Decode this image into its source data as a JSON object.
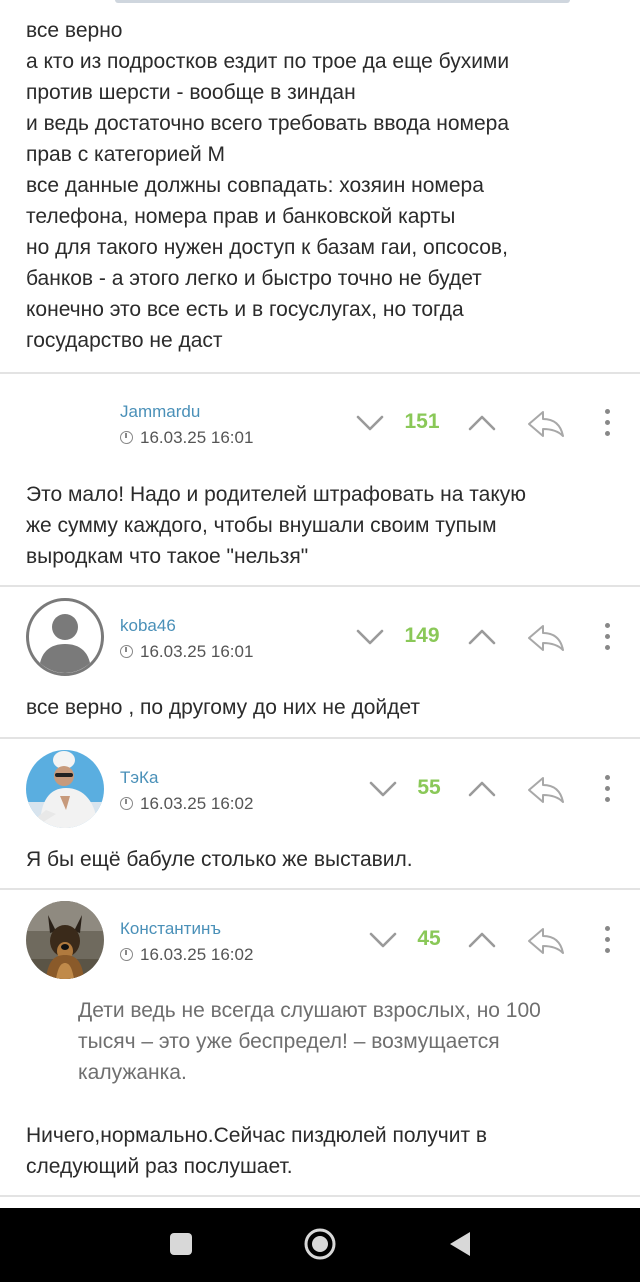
{
  "post": {
    "lines": [
      "все верно",
      "а кто из подростков ездит по трое да еще бухими",
      "против шерсти - вообще в зиндан",
      "и ведь достаточно всего требовать ввода номера",
      "прав с категорией М",
      "все данные должны совпадать: хозяин номера",
      "телефона, номера прав и банковской карты",
      "но для такого нужен доступ к базам гаи, опсосов,",
      "банков - а этого легко и быстро точно не будет",
      "конечно это все есть и в госуслугах, но тогда",
      "государство не даст"
    ]
  },
  "comments": [
    {
      "username": "Jammardu",
      "time": "16.03.25 16:01",
      "rating": "151",
      "text_lines": [
        "Это мало! Надо и родителей штрафовать на такую",
        "же сумму каждого, чтобы внушали своим тупым",
        "выродкам что такое \"нельзя\""
      ]
    },
    {
      "username": "koba46",
      "time": "16.03.25 16:01",
      "rating": "149",
      "avatar": "default-user-avatar",
      "text_lines": [
        "все верно , по другому до них не дойдет"
      ]
    },
    {
      "username": "ТэКа",
      "time": "16.03.25 16:02",
      "rating": "55",
      "avatar": "person-photo-avatar",
      "text_lines": [
        "Я бы ещё бабуле столько же выставил."
      ]
    },
    {
      "username": "Константинъ",
      "time": "16.03.25 16:02",
      "rating": "45",
      "avatar": "dog-photo-avatar",
      "quote_lines": [
        "Дети ведь не всегда слушают взрослых, но 100",
        "тысяч – это уже беспредел! – возмущается",
        "калужанка."
      ],
      "text_lines": [
        "Ничего,нормально.Сейчас пиздюлей получит в",
        "следующий раз послушает."
      ]
    }
  ],
  "icons": {
    "downvote": "chevron-down-icon",
    "upvote": "chevron-up-icon",
    "reply": "reply-arrow-icon",
    "more": "more-vertical-icon",
    "time": "clock-icon"
  },
  "colors": {
    "rating": "#8ac858",
    "username": "#4a90b8",
    "divider": "#e3e3e3",
    "quote": "#6f6f6f"
  },
  "navbar": [
    "square-recents-icon",
    "circle-home-icon",
    "triangle-back-icon"
  ]
}
